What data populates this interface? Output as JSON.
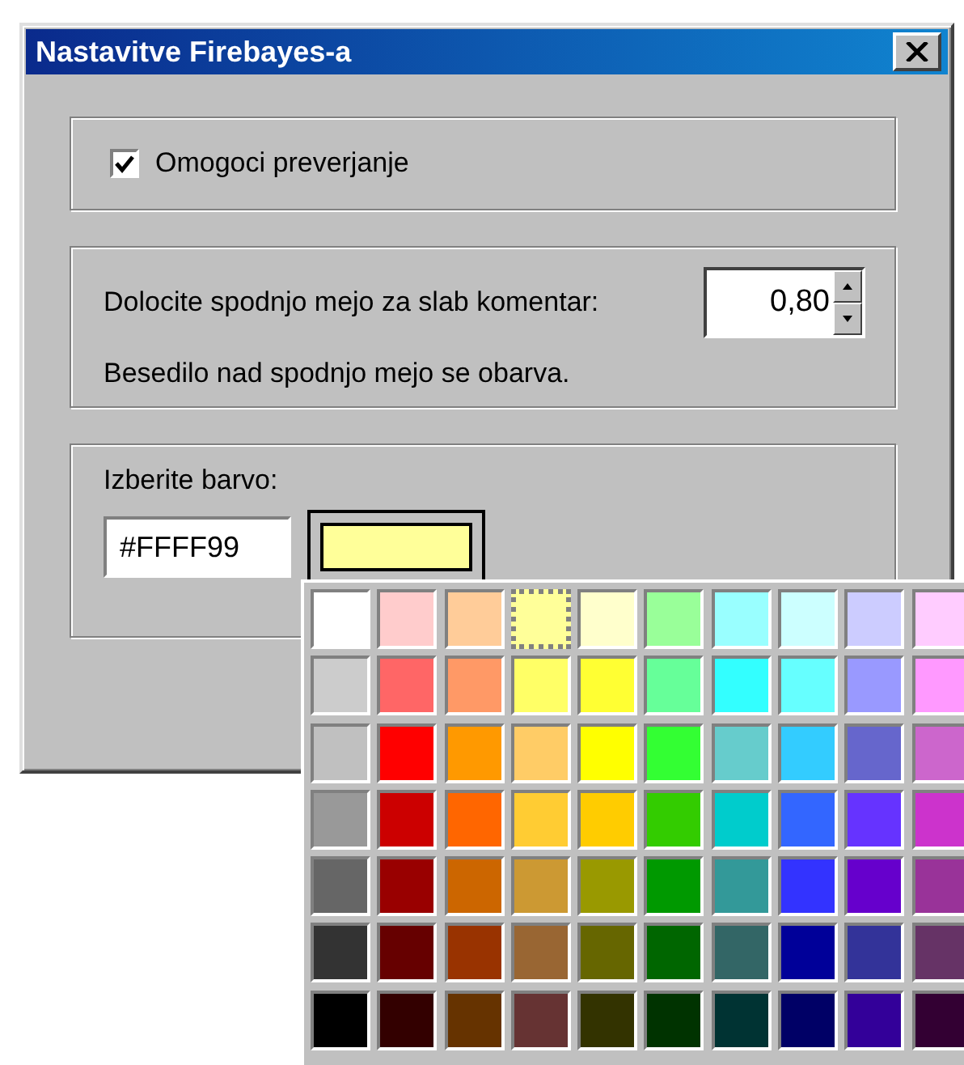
{
  "window": {
    "title": "Nastavitve Firebayes-a"
  },
  "enable": {
    "label": "Omogoci preverjanje",
    "checked": true
  },
  "threshold": {
    "label": "Dolocite spodnjo mejo za slab komentar:",
    "value": "0,80",
    "note": "Besedilo nad spodnjo mejo se obarva."
  },
  "color": {
    "label": "Izberite barvo:",
    "value": "#FFFF99",
    "swatch": {
      "color": "#ffff99"
    }
  },
  "palette": [
    [
      {
        "color": "#ffffff",
        "selected": false
      },
      {
        "color": "#ffcccc",
        "selected": false
      },
      {
        "color": "#ffcc99",
        "selected": false
      },
      {
        "color": "#ffff99",
        "selected": true
      },
      {
        "color": "#ffffcc",
        "selected": false
      },
      {
        "color": "#99ff99",
        "selected": false
      },
      {
        "color": "#99ffff",
        "selected": false
      },
      {
        "color": "#ccffff",
        "selected": false
      },
      {
        "color": "#ccccff",
        "selected": false
      },
      {
        "color": "#ffccff",
        "selected": false
      }
    ],
    [
      {
        "color": "#cccccc",
        "selected": false
      },
      {
        "color": "#ff6666",
        "selected": false
      },
      {
        "color": "#ff9966",
        "selected": false
      },
      {
        "color": "#ffff66",
        "selected": false
      },
      {
        "color": "#ffff33",
        "selected": false
      },
      {
        "color": "#66ff99",
        "selected": false
      },
      {
        "color": "#33ffff",
        "selected": false
      },
      {
        "color": "#66ffff",
        "selected": false
      },
      {
        "color": "#9999ff",
        "selected": false
      },
      {
        "color": "#ff99ff",
        "selected": false
      }
    ],
    [
      {
        "color": "#c0c0c0",
        "selected": false
      },
      {
        "color": "#ff0000",
        "selected": false
      },
      {
        "color": "#ff9900",
        "selected": false
      },
      {
        "color": "#ffcc66",
        "selected": false
      },
      {
        "color": "#ffff00",
        "selected": false
      },
      {
        "color": "#33ff33",
        "selected": false
      },
      {
        "color": "#66cccc",
        "selected": false
      },
      {
        "color": "#33ccff",
        "selected": false
      },
      {
        "color": "#6666cc",
        "selected": false
      },
      {
        "color": "#cc66cc",
        "selected": false
      }
    ],
    [
      {
        "color": "#999999",
        "selected": false
      },
      {
        "color": "#cc0000",
        "selected": false
      },
      {
        "color": "#ff6600",
        "selected": false
      },
      {
        "color": "#ffcc33",
        "selected": false
      },
      {
        "color": "#ffcc00",
        "selected": false
      },
      {
        "color": "#33cc00",
        "selected": false
      },
      {
        "color": "#00cccc",
        "selected": false
      },
      {
        "color": "#3366ff",
        "selected": false
      },
      {
        "color": "#6633ff",
        "selected": false
      },
      {
        "color": "#cc33cc",
        "selected": false
      }
    ],
    [
      {
        "color": "#666666",
        "selected": false
      },
      {
        "color": "#990000",
        "selected": false
      },
      {
        "color": "#cc6600",
        "selected": false
      },
      {
        "color": "#cc9933",
        "selected": false
      },
      {
        "color": "#999900",
        "selected": false
      },
      {
        "color": "#009900",
        "selected": false
      },
      {
        "color": "#339999",
        "selected": false
      },
      {
        "color": "#3333ff",
        "selected": false
      },
      {
        "color": "#6600cc",
        "selected": false
      },
      {
        "color": "#993399",
        "selected": false
      }
    ],
    [
      {
        "color": "#333333",
        "selected": false
      },
      {
        "color": "#660000",
        "selected": false
      },
      {
        "color": "#993300",
        "selected": false
      },
      {
        "color": "#996633",
        "selected": false
      },
      {
        "color": "#666600",
        "selected": false
      },
      {
        "color": "#006600",
        "selected": false
      },
      {
        "color": "#336666",
        "selected": false
      },
      {
        "color": "#000099",
        "selected": false
      },
      {
        "color": "#333399",
        "selected": false
      },
      {
        "color": "#663366",
        "selected": false
      }
    ],
    [
      {
        "color": "#000000",
        "selected": false
      },
      {
        "color": "#330000",
        "selected": false
      },
      {
        "color": "#663300",
        "selected": false
      },
      {
        "color": "#663333",
        "selected": false
      },
      {
        "color": "#333300",
        "selected": false
      },
      {
        "color": "#003300",
        "selected": false
      },
      {
        "color": "#003333",
        "selected": false
      },
      {
        "color": "#000066",
        "selected": false
      },
      {
        "color": "#330099",
        "selected": false
      },
      {
        "color": "#330033",
        "selected": false
      }
    ]
  ]
}
